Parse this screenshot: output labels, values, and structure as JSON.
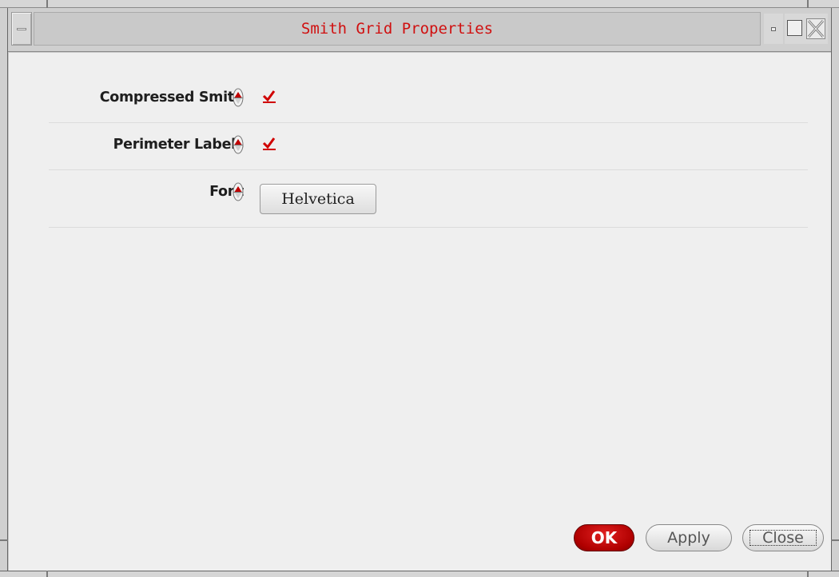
{
  "window": {
    "title": "Smith Grid Properties",
    "title_color": "#d01010",
    "icons": {
      "menu": "window-menu-icon",
      "minimize": "minimize-icon",
      "maximize": "maximize-icon",
      "close": "close-icon"
    }
  },
  "form": {
    "rows": [
      {
        "label": "Compressed Smith",
        "type": "checkbox",
        "checked": true
      },
      {
        "label": "Perimeter Labels",
        "type": "checkbox",
        "checked": true
      },
      {
        "label": "Font",
        "type": "button",
        "value": "Helvetica"
      }
    ]
  },
  "footer": {
    "ok_label": "OK",
    "apply_label": "Apply",
    "close_label": "Close"
  },
  "colors": {
    "accent": "#c00000",
    "check": "#d00000",
    "background": "#efefef"
  }
}
